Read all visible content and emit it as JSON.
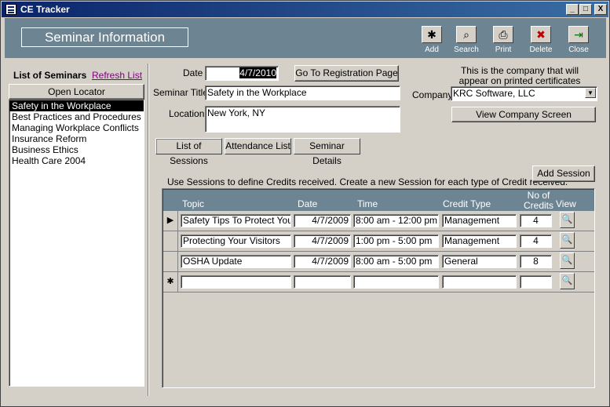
{
  "window": {
    "title": "CE Tracker",
    "min_label": "_",
    "max_label": "□",
    "close_label": "X"
  },
  "header": {
    "title": "Seminar Information",
    "toolbar": [
      {
        "label": "Add",
        "icon": "add-record-icon",
        "glyph": "✱"
      },
      {
        "label": "Search",
        "icon": "binoculars-icon",
        "glyph": "⌕"
      },
      {
        "label": "Print",
        "icon": "printer-icon",
        "glyph": "⎙"
      },
      {
        "label": "Delete",
        "icon": "delete-icon",
        "glyph": "✖"
      },
      {
        "label": "Close",
        "icon": "close-door-icon",
        "glyph": "⇥"
      }
    ]
  },
  "sidebar": {
    "heading": "List of Seminars",
    "refresh_label": "Refresh List",
    "open_locator_label": "Open Locator",
    "items": [
      "Safety in the Workplace",
      "Best Practices and Procedures",
      "Managing Workplace Conflicts",
      "Insurance Reform",
      "Business Ethics",
      "Health Care 2004"
    ]
  },
  "form": {
    "date_label": "Date",
    "date_value": "4/7/2010",
    "registration_button": "Go To Registration Page",
    "title_label": "Seminar Title",
    "title_value": "Safety in the Workplace",
    "location_label": "Location",
    "location_value": "New York, NY",
    "company_note": "This is the company that will appear on printed certificates",
    "company_label": "Company",
    "company_value": "KRC Software, LLC",
    "view_company_button": "View Company Screen"
  },
  "tabs": [
    "List of Sessions",
    "Attendance List",
    "Seminar Details"
  ],
  "sessions": {
    "hint": "Use Sessions to define Credits received.  Create a new Session for each type of Credit received.",
    "add_label": "Add Session",
    "columns": {
      "topic": "Topic",
      "date": "Date",
      "time": "Time",
      "credit_type": "Credit Type",
      "credits": "No of Credits",
      "view": "View"
    },
    "rows": [
      {
        "topic": "Safety Tips To Protect Your E",
        "date": "4/7/2009",
        "time": "8:00 am - 12:00 pm",
        "credit_type": "Management",
        "credits": "4"
      },
      {
        "topic": "Protecting Your Visitors",
        "date": "4/7/2009",
        "time": "1:00 pm - 5:00 pm",
        "credit_type": "Management",
        "credits": "4"
      },
      {
        "topic": "OSHA Update",
        "date": "4/7/2009",
        "time": "8:00 am - 5:00 pm",
        "credit_type": "General",
        "credits": "8"
      }
    ],
    "current_marker": "▶",
    "new_marker": "✱"
  }
}
